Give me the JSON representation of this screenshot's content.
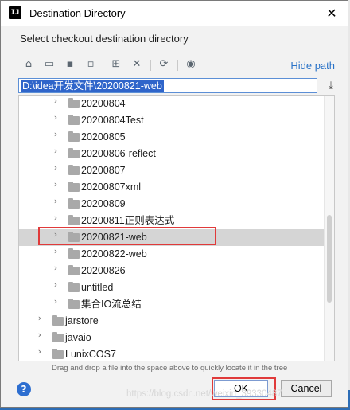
{
  "window": {
    "app_icon": "IJ",
    "title": "Destination Directory",
    "close_glyph": "✕"
  },
  "subtitle": "Select checkout destination directory",
  "toolbar": {
    "icons": [
      "home-icon",
      "desktop-icon",
      "project-icon",
      "module-icon",
      "new-folder-icon",
      "delete-icon",
      "refresh-icon",
      "show-hidden-icon"
    ],
    "hide_path_label": "Hide path"
  },
  "path": {
    "value": "D:\\idea开发文件\\20200821-web"
  },
  "tree": {
    "items": [
      {
        "label": "20200804"
      },
      {
        "label": "20200804Test"
      },
      {
        "label": "20200805"
      },
      {
        "label": "20200806-reflect"
      },
      {
        "label": "20200807"
      },
      {
        "label": "20200807xml"
      },
      {
        "label": "20200809"
      },
      {
        "label": "20200811正则表达式"
      },
      {
        "label": "20200821-web",
        "selected": true
      },
      {
        "label": "20200822-web"
      },
      {
        "label": "20200826"
      },
      {
        "label": "untitled"
      },
      {
        "label": "集合IO流总结"
      },
      {
        "label": "jarstore"
      },
      {
        "label": "javaio"
      },
      {
        "label": "LunixCOS7"
      }
    ]
  },
  "hint": "Drag and drop a file into the space above to quickly locate it in the tree",
  "buttons": {
    "help": "?",
    "ok": "OK",
    "cancel": "Cancel"
  },
  "watermark": "https://blog.csdn.net/weixin_39330487"
}
